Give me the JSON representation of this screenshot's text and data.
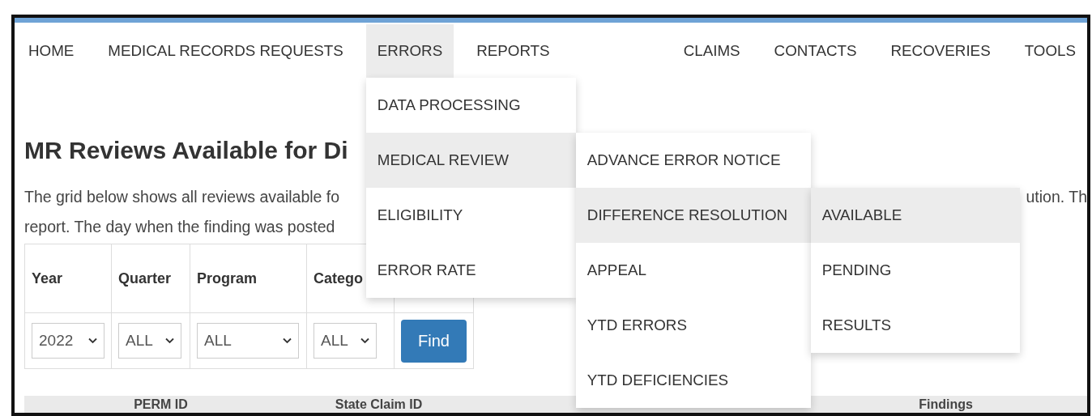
{
  "nav": [
    {
      "label": "HOME",
      "selected": false
    },
    {
      "label": "MEDICAL RECORDS REQUESTS",
      "selected": false
    },
    {
      "label": "ERRORS",
      "selected": true,
      "children": [
        {
          "label": "DATA PROCESSING",
          "selected": false
        },
        {
          "label": "MEDICAL REVIEW",
          "selected": true,
          "children": [
            {
              "label": "ADVANCE ERROR NOTICE",
              "selected": false
            },
            {
              "label": "DIFFERENCE RESOLUTION",
              "selected": true,
              "children": [
                {
                  "label": "AVAILABLE",
                  "selected": true
                },
                {
                  "label": "PENDING",
                  "selected": false
                },
                {
                  "label": "RESULTS",
                  "selected": false
                }
              ]
            },
            {
              "label": "APPEAL",
              "selected": false
            },
            {
              "label": "YTD ERRORS",
              "selected": false
            },
            {
              "label": "YTD DEFICIENCIES",
              "selected": false
            }
          ]
        },
        {
          "label": "ELIGIBILITY",
          "selected": false
        },
        {
          "label": "ERROR RATE",
          "selected": false
        }
      ]
    },
    {
      "label": "REPORTS",
      "selected": false
    },
    {
      "label": "CLAIMS",
      "selected": false
    },
    {
      "label": "CONTACTS",
      "selected": false
    },
    {
      "label": "RECOVERIES",
      "selected": false
    },
    {
      "label": "TOOLS",
      "selected": false
    }
  ],
  "heading": "MR Reviews Available for Di",
  "description": {
    "line_1": "The grid below shows all reviews available fo",
    "line_1_end": "ution. Th",
    "line_2": "report. The day when the finding was posted"
  },
  "filters": [
    {
      "label": "Year",
      "value": "2022"
    },
    {
      "label": "Quarter",
      "value": "ALL"
    },
    {
      "label": "Program",
      "value": "ALL"
    },
    {
      "label": "Catego",
      "value": "ALL"
    }
  ],
  "find_button": "Find",
  "grid": {
    "columns": [
      "PERM ID",
      "State Claim ID",
      "Findings"
    ]
  }
}
